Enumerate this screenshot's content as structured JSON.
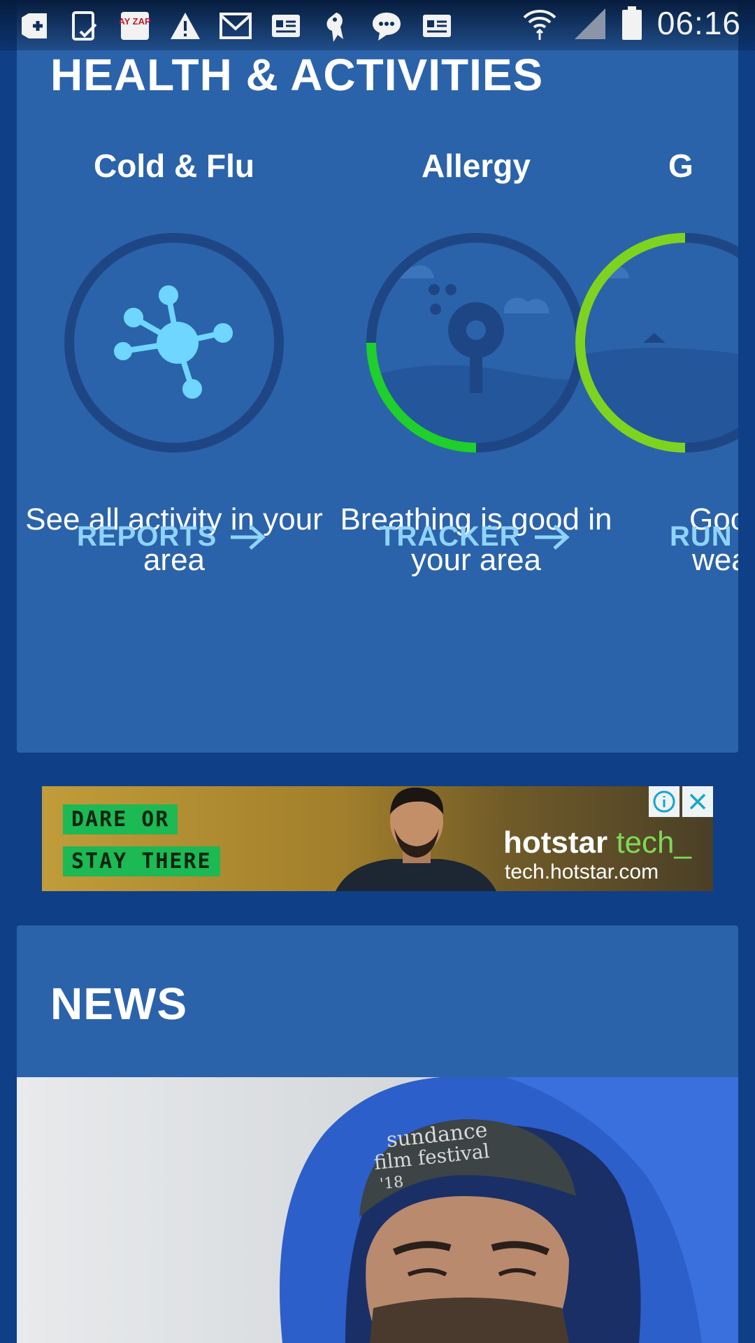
{
  "status_bar": {
    "time": "06:16",
    "left_icons": [
      "add-box-icon",
      "tablet-check-icon",
      "payzapp-icon",
      "warning-icon",
      "gmail-icon",
      "news-card-icon",
      "app-mascot-icon",
      "chat-bubble-icon",
      "news-card-icon"
    ],
    "payzapp_text": "PAY ZAPP",
    "right_icons": [
      "wifi-icon",
      "signal-icon",
      "battery-icon"
    ]
  },
  "health": {
    "title": "HEALTH & ACTIVITIES",
    "activities": [
      {
        "name": "Cold & Flu",
        "description": "See all activity in your area",
        "link": "REPORTS",
        "icon": "virus-icon"
      },
      {
        "name": "Allergy",
        "description": "Breathing is good in your area",
        "link": "TRACKER",
        "icon": "tree-icon",
        "level": 0.25
      },
      {
        "name": "G",
        "description_line1": "Good",
        "description_line2": "weat",
        "link": "RUN T",
        "icon": "mountain-icon",
        "level": 0.5
      }
    ]
  },
  "ad": {
    "tag_line1": "DARE OR",
    "tag_line2": "STAY THERE",
    "brand": "hotstar",
    "brand_accent": "tech_",
    "url": "tech.hotstar.com"
  },
  "news": {
    "title": "NEWS",
    "hat_text_line1": "sundance",
    "hat_text_line2": "film festival",
    "hat_text_line3": "'18"
  },
  "colors": {
    "background": "#0f3f86",
    "card": "#2b63aa",
    "gauge_ring": "#1e4685",
    "gauge_green": "#1fcf2c",
    "gauge_lime": "#7ed321",
    "link": "#8fd4ff",
    "virus": "#6fd6ff"
  }
}
